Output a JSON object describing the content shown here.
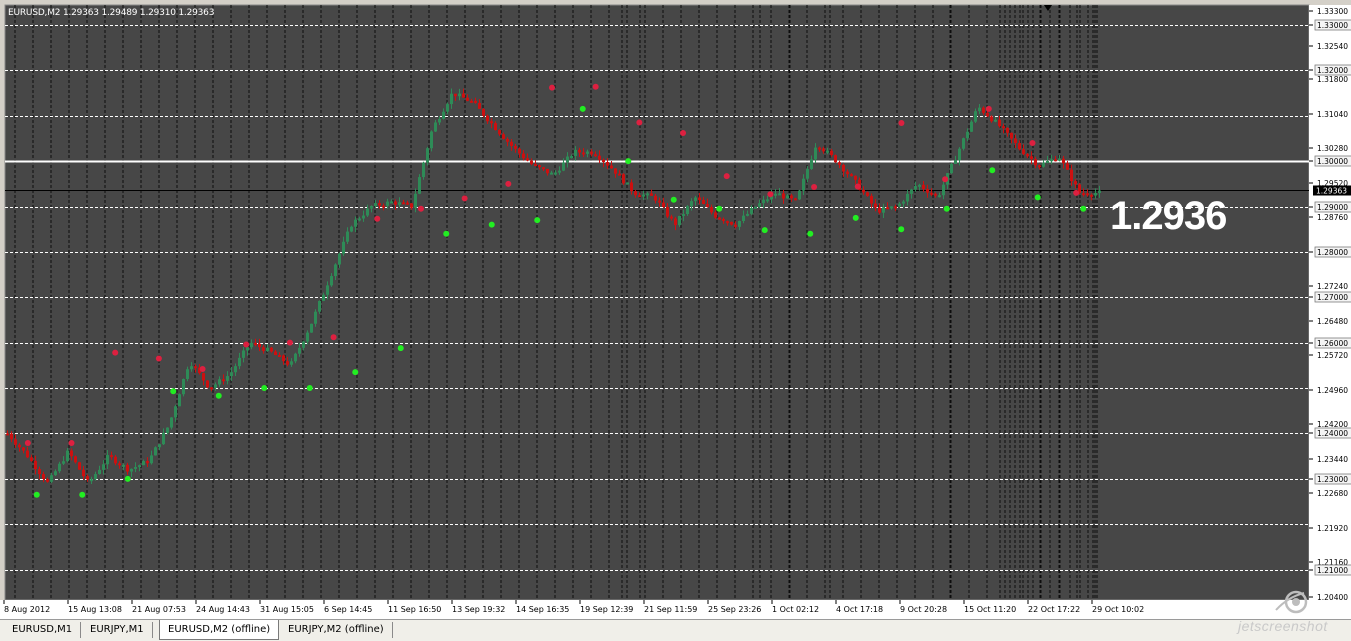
{
  "chart_window": {
    "info_label": "EURUSD,M2  1.29363 1.29489 1.29310 1.29363",
    "current_price_label": "1.29363",
    "big_price_text": "1.2936"
  },
  "colors": {
    "background": "#474747",
    "grid": "#ffffff",
    "up_candles": "#2e8b57",
    "down_candles": "#cc1010",
    "upper_dots": "#dd2040",
    "lower_dots": "#22ee22",
    "level_line": "#ffffff",
    "current_line": "#000000"
  },
  "chart_data": {
    "type": "candlestick",
    "symbol": "EURUSD",
    "timeframe": "M2",
    "ylim": [
      1.2033,
      1.3344
    ],
    "yticks": [
      "1.33300",
      "1.33000",
      "1.32540",
      "1.32000",
      "1.31800",
      "1.31040",
      "1.30280",
      "1.30000",
      "1.29520",
      "1.29000",
      "1.28760",
      "1.28000",
      "1.27240",
      "1.27000",
      "1.26480",
      "1.26000",
      "1.25720",
      "1.24960",
      "1.24200",
      "1.24000",
      "1.23440",
      "1.23000",
      "1.22680",
      "1.21920",
      "1.21160",
      "1.21000",
      "1.20400"
    ],
    "highlighted_levels": [
      "1.33000",
      "1.32000",
      "1.31000",
      "1.30000",
      "1.29000",
      "1.28000",
      "1.27000",
      "1.26000",
      "1.25000",
      "1.24000",
      "1.23000",
      "1.22000",
      "1.21000"
    ],
    "level_line": 1.3,
    "current_price": 1.29363,
    "xticks": [
      "8 Aug 2012",
      "15 Aug 13:08",
      "21 Aug 07:53",
      "24 Aug 14:43",
      "31 Aug 15:05",
      "6 Sep 14:45",
      "11 Sep 16:50",
      "13 Sep 19:32",
      "14 Sep 16:35",
      "19 Sep 12:39",
      "21 Sep 11:59",
      "25 Sep 23:26",
      "1 Oct 02:12",
      "4 Oct 17:18",
      "9 Oct 20:28",
      "15 Oct 11:20",
      "22 Oct 17:22",
      "29 Oct 10:02"
    ],
    "price_path": [
      1.24,
      1.235,
      1.229,
      1.236,
      1.229,
      1.235,
      1.232,
      1.234,
      1.242,
      1.256,
      1.25,
      1.253,
      1.26,
      1.258,
      1.255,
      1.264,
      1.275,
      1.286,
      1.29,
      1.291,
      1.29,
      1.307,
      1.315,
      1.313,
      1.308,
      1.303,
      1.299,
      1.297,
      1.302,
      1.302,
      1.298,
      1.293,
      1.292,
      1.286,
      1.292,
      1.288,
      1.286,
      1.29,
      1.293,
      1.291,
      1.304,
      1.3,
      1.295,
      1.289,
      1.29,
      1.295,
      1.292,
      1.302,
      1.312,
      1.308,
      1.303,
      1.299,
      1.301,
      1.293,
      1.293
    ],
    "upper_dots": [
      1.2379,
      1.2379,
      1.2578,
      1.2565,
      1.2542,
      1.2596,
      1.26,
      1.2612,
      1.2873,
      1.2895,
      1.2918,
      1.295,
      1.3162,
      1.3164,
      1.3085,
      1.3062,
      1.2967,
      1.2927,
      1.2943,
      1.2944,
      1.3084,
      1.296,
      1.3115,
      1.304,
      1.293
    ],
    "lower_dots": [
      1.2265,
      1.2265,
      1.23,
      1.2493,
      1.2483,
      1.25,
      1.25,
      1.2535,
      1.2588,
      1.284,
      1.286,
      1.287,
      1.3115,
      1.3,
      1.2915,
      1.2895,
      1.2848,
      1.284,
      1.2875,
      1.285,
      1.2895,
      1.298,
      1.292,
      1.2895
    ]
  },
  "tabs": [
    "EURUSD,M1",
    "EURJPY,M1",
    "EURUSD,M2 (offline)",
    "EURJPY,M2 (offline)"
  ],
  "active_tab": 2,
  "watermark": {
    "text": "jetscreenshot"
  }
}
